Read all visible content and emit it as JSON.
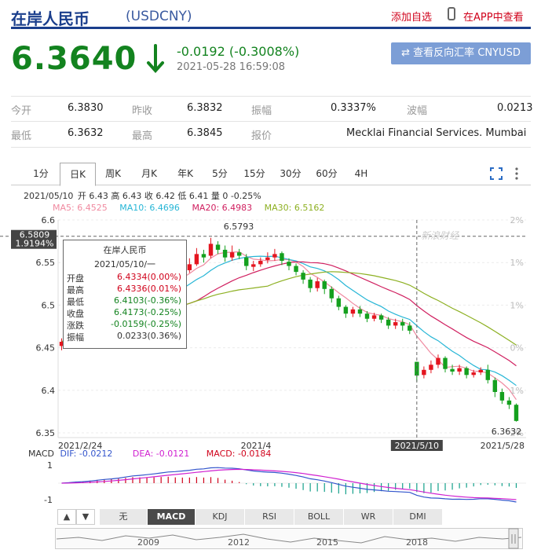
{
  "header": {
    "title": "在岸人民币",
    "symbol": "(USDCNY)",
    "add_favorite": "添加自选",
    "app_view": "在APP中查看"
  },
  "quote": {
    "price": "6.3640",
    "change": "-0.0192 (-0.3008%)",
    "timestamp": "2021-05-28 16:59:08",
    "reverse_button": "⇄ 查看反向汇率 CNYUSD",
    "direction": "down",
    "color_down": "#13831f",
    "color_up": "#d0021b"
  },
  "stats": {
    "open_label": "今开",
    "open": "6.3830",
    "prev_close_label": "昨收",
    "prev_close": "6.3832",
    "amplitude_label": "振幅",
    "amplitude": "0.3337%",
    "volatility_label": "波幅",
    "volatility": "0.0213",
    "low_label": "最低",
    "low": "6.3632",
    "high_label": "最高",
    "high": "6.3845",
    "quote_label": "报价",
    "quote_source": "Mecklai Financial Services. Mumbai"
  },
  "period_tabs": [
    "1分",
    "日K",
    "周K",
    "月K",
    "年K",
    "5分",
    "15分",
    "30分",
    "60分",
    "4H"
  ],
  "active_period": "日K",
  "chart_info": {
    "date": "2021/05/10",
    "text": "开 6.43 高 6.43 收 6.42 低 6.41 量 0 -0.25%"
  },
  "ma_legend": {
    "ma5": "MA5: 6.4525",
    "ma10": "MA10: 6.4696",
    "ma20": "MA20: 6.4983",
    "ma30": "MA30: 6.5162"
  },
  "tooltip": {
    "title": "在岸人民币",
    "date": "2021/05/10/一",
    "rows": [
      {
        "label": "开盘",
        "value": "6.4334(0.00%)"
      },
      {
        "label": "最高",
        "value": "6.4336(0.01%)"
      },
      {
        "label": "最低",
        "value": "6.4103(-0.36%)"
      },
      {
        "label": "收盘",
        "value": "6.4173(-0.25%)"
      },
      {
        "label": "涨跌",
        "value": "-0.0159(-0.25%)"
      },
      {
        "label": "振幅",
        "value": "0.0233(0.36%)"
      }
    ]
  },
  "chart_data": {
    "type": "candlestick",
    "y_ticks": [
      "6.6",
      "6.55",
      "6.5",
      "6.45",
      "6.4",
      "6.35"
    ],
    "ylim": [
      6.35,
      6.6
    ],
    "pct_ticks": [
      "2%",
      "1%",
      "1%",
      "0%",
      "1%",
      "2%"
    ],
    "x_ticks": [
      "2021/2/24",
      "2021/4",
      "2021/5/10",
      "2021/5/28"
    ],
    "crosshair_price": "6.5809",
    "crosshair_pct": "1.9194%",
    "max_label": "6.5793",
    "last_label": "6.3632",
    "watermark": "新浪财经",
    "candles": [
      [
        6.452,
        6.457,
        6.461,
        6.447
      ],
      [
        6.458,
        6.466,
        6.468,
        6.455
      ],
      [
        6.466,
        6.472,
        6.476,
        6.462
      ],
      [
        6.472,
        6.47,
        6.478,
        6.466
      ],
      [
        6.47,
        6.476,
        6.48,
        6.467
      ],
      [
        6.478,
        6.483,
        6.488,
        6.475
      ],
      [
        6.484,
        6.488,
        6.492,
        6.48
      ],
      [
        6.488,
        6.486,
        6.494,
        6.482
      ],
      [
        6.487,
        6.495,
        6.5,
        6.485
      ],
      [
        6.496,
        6.505,
        6.51,
        6.494
      ],
      [
        6.505,
        6.512,
        6.518,
        6.503
      ],
      [
        6.512,
        6.508,
        6.516,
        6.504
      ],
      [
        6.508,
        6.514,
        6.52,
        6.505
      ],
      [
        6.515,
        6.521,
        6.526,
        6.512
      ],
      [
        6.522,
        6.53,
        6.536,
        6.519
      ],
      [
        6.531,
        6.536,
        6.542,
        6.527
      ],
      [
        6.536,
        6.532,
        6.541,
        6.528
      ],
      [
        6.532,
        6.54,
        6.546,
        6.53
      ],
      [
        6.541,
        6.548,
        6.555,
        6.538
      ],
      [
        6.548,
        6.56,
        6.567,
        6.546
      ],
      [
        6.56,
        6.556,
        6.565,
        6.55
      ],
      [
        6.558,
        6.572,
        6.579,
        6.555
      ],
      [
        6.571,
        6.565,
        6.575,
        6.56
      ],
      [
        6.565,
        6.556,
        6.57,
        6.551
      ],
      [
        6.556,
        6.562,
        6.57,
        6.552
      ],
      [
        6.562,
        6.558,
        6.566,
        6.554
      ],
      [
        6.556,
        6.546,
        6.56,
        6.541
      ],
      [
        6.545,
        6.548,
        6.552,
        6.54
      ],
      [
        6.548,
        6.552,
        6.556,
        6.545
      ],
      [
        6.553,
        6.556,
        6.562,
        6.549
      ],
      [
        6.556,
        6.56,
        6.566,
        6.552
      ],
      [
        6.561,
        6.552,
        6.563,
        6.547
      ],
      [
        6.551,
        6.546,
        6.555,
        6.541
      ],
      [
        6.546,
        6.539,
        6.549,
        6.535
      ],
      [
        6.538,
        6.53,
        6.541,
        6.525
      ],
      [
        6.53,
        6.52,
        6.533,
        6.515
      ],
      [
        6.52,
        6.528,
        6.532,
        6.516
      ],
      [
        6.528,
        6.519,
        6.53,
        6.513
      ],
      [
        6.519,
        6.508,
        6.522,
        6.503
      ],
      [
        6.508,
        6.498,
        6.511,
        6.494
      ],
      [
        6.498,
        6.49,
        6.5,
        6.485
      ],
      [
        6.49,
        6.495,
        6.498,
        6.486
      ],
      [
        6.495,
        6.49,
        6.499,
        6.486
      ],
      [
        6.49,
        6.484,
        6.493,
        6.48
      ],
      [
        6.484,
        6.488,
        6.491,
        6.481
      ],
      [
        6.488,
        6.483,
        6.49,
        6.479
      ],
      [
        6.483,
        6.476,
        6.486,
        6.472
      ],
      [
        6.476,
        6.48,
        6.484,
        6.472
      ],
      [
        6.48,
        6.476,
        6.484,
        6.47
      ],
      [
        6.476,
        6.47,
        6.48,
        6.466
      ],
      [
        6.4334,
        6.4173,
        6.4336,
        6.4103
      ],
      [
        6.418,
        6.424,
        6.428,
        6.414
      ],
      [
        6.424,
        6.43,
        6.435,
        6.42
      ],
      [
        6.43,
        6.438,
        6.442,
        6.426
      ],
      [
        6.438,
        6.425,
        6.44,
        6.421
      ],
      [
        6.425,
        6.422,
        6.43,
        6.418
      ],
      [
        6.422,
        6.426,
        6.43,
        6.418
      ],
      [
        6.426,
        6.418,
        6.428,
        6.414
      ],
      [
        6.418,
        6.421,
        6.424,
        6.415
      ],
      [
        6.421,
        6.424,
        6.427,
        6.418
      ],
      [
        6.424,
        6.412,
        6.43,
        6.408
      ],
      [
        6.412,
        6.398,
        6.415,
        6.392
      ],
      [
        6.398,
        6.388,
        6.402,
        6.384
      ],
      [
        6.388,
        6.383,
        6.392,
        6.378
      ],
      [
        6.383,
        6.364,
        6.3845,
        6.3632
      ]
    ]
  },
  "macd_legend": {
    "label": "MACD",
    "dif": "DIF: -0.0212",
    "dea": "DEA: -0.0121",
    "macd": "MACD: -0.0184"
  },
  "macd_ticks": [
    "1",
    "-1"
  ],
  "indicator_tabs": [
    "无",
    "MACD",
    "KDJ",
    "RSI",
    "BOLL",
    "WR",
    "DMI"
  ],
  "active_indicator": "MACD",
  "scroller_years": [
    "2009",
    "2012",
    "2015",
    "2018"
  ]
}
